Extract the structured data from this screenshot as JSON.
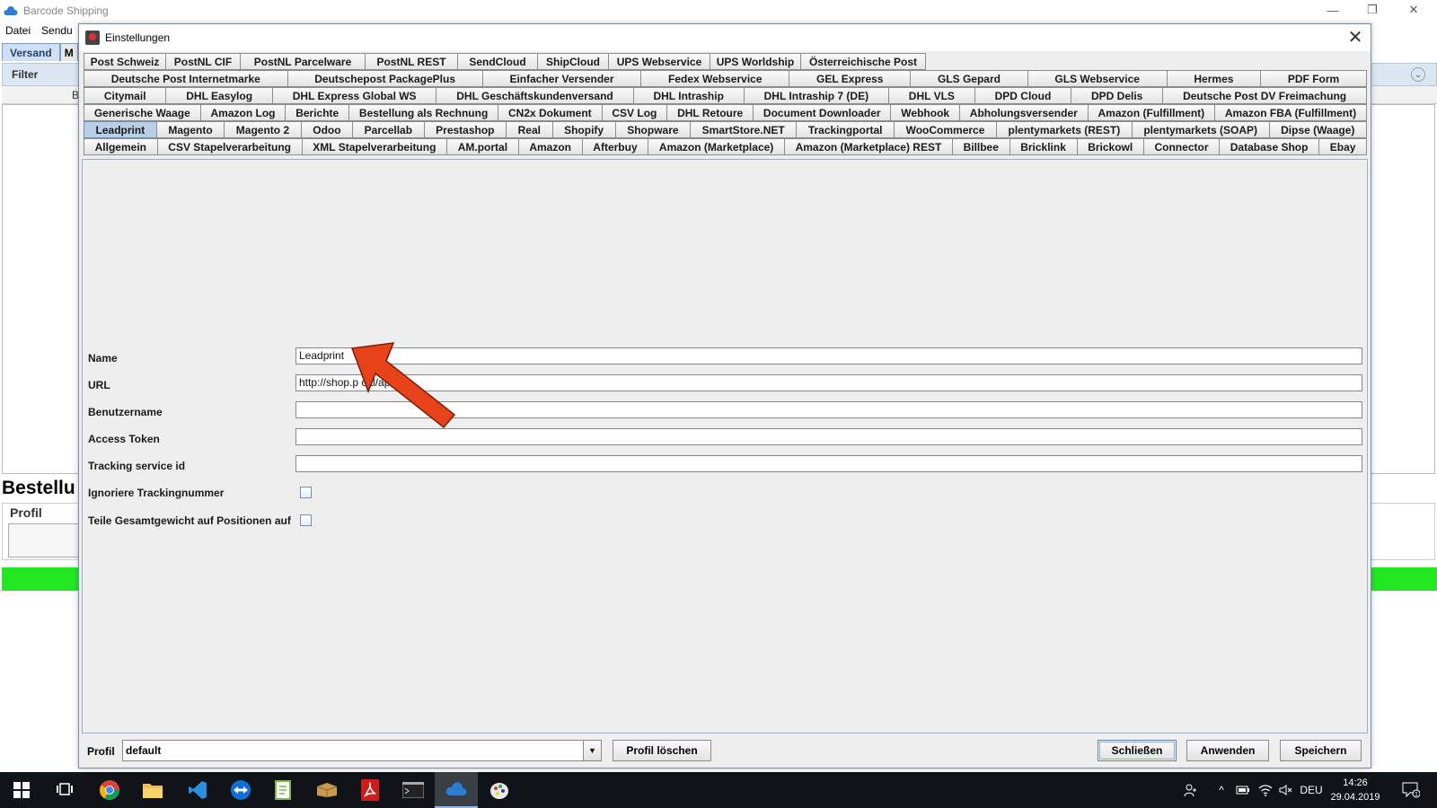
{
  "main_window": {
    "title": "Barcode Shipping",
    "menu": [
      "Datei",
      "Sendu"
    ],
    "tabs": [
      "Versand",
      "M"
    ],
    "filter_label": "Filter",
    "sub_label": "B",
    "section_title": "Bestellu",
    "profil_label": "Profil"
  },
  "dialog": {
    "title": "Einstellungen",
    "close_label": "✕",
    "tab_rows": [
      [
        "Post Schweiz",
        "PostNL CIF",
        "PostNL Parcelware",
        "PostNL REST",
        "SendCloud",
        "ShipCloud",
        "UPS Webservice",
        "UPS Worldship",
        "Österreichische Post"
      ],
      [
        "Deutsche Post Internetmarke",
        "Deutschepost PackagePlus",
        "Einfacher Versender",
        "Fedex Webservice",
        "GEL Express",
        "GLS Gepard",
        "GLS Webservice",
        "Hermes",
        "PDF Form"
      ],
      [
        "Citymail",
        "DHL Easylog",
        "DHL Express Global WS",
        "DHL Geschäftskundenversand",
        "DHL Intraship",
        "DHL Intraship 7 (DE)",
        "DHL VLS",
        "DPD Cloud",
        "DPD Delis",
        "Deutsche Post DV Freimachung"
      ],
      [
        "Generische Waage",
        "Amazon Log",
        "Berichte",
        "Bestellung als Rechnung",
        "CN2x Dokument",
        "CSV Log",
        "DHL Retoure",
        "Document Downloader",
        "Webhook",
        "Abholungsversender",
        "Amazon (Fulfillment)",
        "Amazon FBA (Fulfillment)"
      ],
      [
        "Leadprint",
        "Magento",
        "Magento 2",
        "Odoo",
        "Parcellab",
        "Prestashop",
        "Real",
        "Shopify",
        "Shopware",
        "SmartStore.NET",
        "Trackingportal",
        "WooCommerce",
        "plentymarkets (REST)",
        "plentymarkets (SOAP)",
        "Dipse (Waage)"
      ],
      [
        "Allgemein",
        "CSV Stapelverarbeitung",
        "XML Stapelverarbeitung",
        "AM.portal",
        "Amazon",
        "Afterbuy",
        "Amazon (Marketplace)",
        "Amazon (Marketplace) REST",
        "Billbee",
        "Bricklink",
        "Brickowl",
        "Connector",
        "Database Shop",
        "Ebay"
      ]
    ],
    "selected_tab": "Leadprint",
    "form": {
      "name_label": "Name",
      "name_value": "Leadprint",
      "url_label": "URL",
      "url_value": "http://shop.p                    cal/api/",
      "username_label": "Benutzername",
      "username_value": "",
      "token_label": "Access Token",
      "token_value": "",
      "tracking_label": "Tracking service id",
      "tracking_value": "",
      "ignore_tracking_label": "Ignoriere Trackingnummer",
      "ignore_tracking_checked": false,
      "split_weight_label": "Teile Gesamtgewicht auf Positionen auf",
      "split_weight_checked": false
    },
    "bottom": {
      "profil_label": "Profil",
      "profil_value": "default",
      "delete_profile_label": "Profil löschen",
      "close_label": "Schließen",
      "apply_label": "Anwenden",
      "save_label": "Speichern"
    }
  },
  "taskbar": {
    "language": "DEU",
    "time": "14:26",
    "date": "29.04.2019",
    "notification_count": "1"
  },
  "colors": {
    "selected_tab": "#b8cfe5",
    "arrow": "#e8421a",
    "status_green": "#22e822",
    "taskbar": "#101418"
  }
}
